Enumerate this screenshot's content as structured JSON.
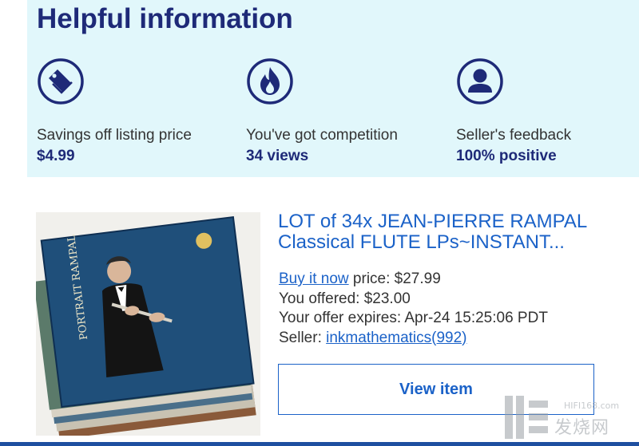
{
  "helpful_info": {
    "heading": "Helpful information",
    "cards": [
      {
        "icon": "price-tag-icon",
        "label": "Savings off listing price",
        "value": "$4.99"
      },
      {
        "icon": "flame-icon",
        "label": "You've got competition",
        "value": "34 views"
      },
      {
        "icon": "user-icon",
        "label": "Seller's feedback",
        "value": "100% positive"
      }
    ]
  },
  "listing": {
    "title": "LOT of 34x JEAN-PIERRE RAMPAL Classical FLUTE LPs~INSTANT...",
    "buy_now_link": "Buy it now",
    "buy_now_price": " price: $27.99",
    "offer": "You offered: $23.00",
    "expires": "Your offer expires: Apr-24 15:25:06 PDT",
    "seller_prefix": "Seller: ",
    "seller_link": "inkmathematics(992)",
    "view_button": "View item",
    "image_text": {
      "cover_title": "PORTRAIT RAMPAL"
    }
  },
  "watermark": {
    "domain": "HIFI168.com",
    "name": "发烧网"
  },
  "colors": {
    "panel_bg": "#e1f7fb",
    "navy": "#1e2a78",
    "link_blue": "#1b62c8",
    "bottom_bar": "#1e4fa0"
  }
}
